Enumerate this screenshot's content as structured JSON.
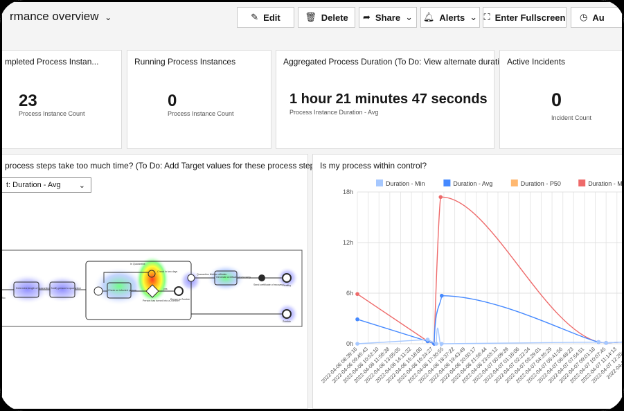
{
  "header": {
    "title": "rmance overview",
    "buttons": {
      "edit": "Edit",
      "delete": "Delete",
      "share": "Share",
      "alerts": "Alerts",
      "fullscreen": "Enter Fullscreen",
      "auto": "Au"
    }
  },
  "kpis": [
    {
      "title": "mpleted Process Instan...",
      "value": "23",
      "sub": "Process Instance Count"
    },
    {
      "title": "Running Process Instances",
      "value": "0",
      "sub": "Process Instance Count"
    },
    {
      "title": "Aggregated Process Duration (To Do: View alternate durati...",
      "value": "1 hour 21 minutes 47 seconds",
      "sub": "Process Instance Duration - Avg"
    },
    {
      "title": "Active Incidents",
      "value": "0",
      "sub": "Incident Count"
    }
  ],
  "heatmap_panel": {
    "title": "process steps take too much time? (To Do: Add Target values for these process steps)",
    "select_value": "t: Duration - Avg",
    "bpmn_labels": {
      "subprocess": "In Quarantine",
      "task1": "Determine length of quarantine",
      "task2": "Notify person to quarantine",
      "task3": "Check on infected person",
      "task4": "Generate certificate of recovery",
      "timer": "Check in two days",
      "msg": "Quarantine lifetime officials",
      "end1": "Healthy",
      "end2": "Zombie",
      "end3": "Person is Zombie",
      "send": "Send certificate of recovery",
      "gw": "Person has turned into a Zombie?",
      "yes": "yes",
      "no": "No"
    }
  },
  "chart_panel": {
    "title": "Is my process within control?"
  },
  "chart_data": {
    "type": "line",
    "title": "Is my process within control?",
    "legend": [
      "Duration - Min",
      "Duration - Avg",
      "Duration - P50",
      "Duration - Max"
    ],
    "legend_position": "top",
    "colors": {
      "min": "#a6c8ff",
      "avg": "#4589ff",
      "p50": "#ffb870",
      "max": "#ee6a6a"
    },
    "y_ticks": [
      "0h",
      "6h",
      "12h",
      "18h"
    ],
    "ylim_hours": [
      0,
      18
    ],
    "x_categories": [
      "2022-04-06 08:39:16",
      "2022-04-06 09:45:43",
      "2022-04-06 10:52:10",
      "2022-04-06 11:58:38",
      "2022-04-06 13:05:05",
      "2022-04-06 14:11:32",
      "2022-04-06 15:18:00",
      "2022-04-06 16:24:27",
      "2022-04-06 17:30:55",
      "2022-04-06 18:37:22",
      "2022-04-06 19:43:49",
      "2022-04-06 20:50:17",
      "2022-04-06 21:56:44",
      "2022-04-06 23:03:12",
      "2022-04-07 00:09:39",
      "2022-04-07 01:16:06",
      "2022-04-07 02:22:34",
      "2022-04-07 03:29:01",
      "2022-04-07 04:35:29",
      "2022-04-07 05:41:56",
      "2022-04-07 06:48:23",
      "2022-04-07 07:54:51",
      "2022-04-07 09:01:18",
      "2022-04-07 10:07:45",
      "2022-04-07 11:14:13",
      "2022-04-07 12:20:40",
      "2022-04-07 13:27:"
    ],
    "series": [
      {
        "name": "Duration - Max",
        "points": [
          [
            0,
            5.9
          ],
          [
            6.5,
            0.3
          ],
          [
            7.1,
            0.0
          ],
          [
            7.7,
            17.4
          ],
          [
            22.3,
            0.2
          ],
          [
            23.0,
            0.1
          ],
          [
            26,
            0.3
          ]
        ]
      },
      {
        "name": "Duration - Avg",
        "points": [
          [
            0,
            2.9
          ],
          [
            6.5,
            0.3
          ],
          [
            7.1,
            0.0
          ],
          [
            7.8,
            5.7
          ],
          [
            22.3,
            0.2
          ],
          [
            23.0,
            0.1
          ],
          [
            26,
            0.3
          ]
        ]
      },
      {
        "name": "Duration - Min",
        "points": [
          [
            0,
            0.0
          ],
          [
            6.5,
            0.5
          ],
          [
            7.3,
            0.0
          ],
          [
            7.8,
            0.0
          ],
          [
            22.3,
            0.2
          ],
          [
            23.0,
            0.1
          ],
          [
            26,
            0.3
          ]
        ]
      }
    ]
  }
}
